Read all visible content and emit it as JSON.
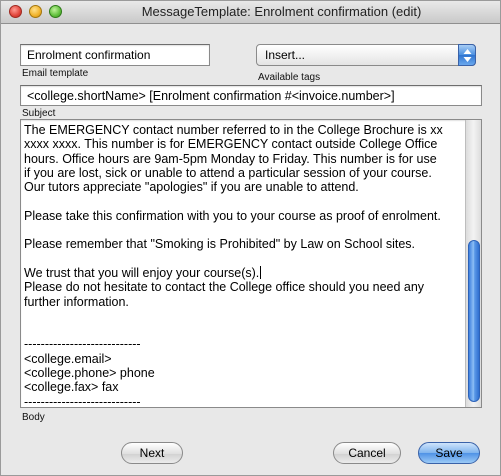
{
  "window": {
    "title": "MessageTemplate: Enrolment confirmation (edit)"
  },
  "template_name": {
    "value": "Enrolment confirmation",
    "label": "Email template"
  },
  "tags": {
    "selected": "Insert...",
    "label": "Available tags"
  },
  "subject": {
    "value": "<college.shortName> [Enrolment confirmation #<invoice.number>]",
    "label": "Subject"
  },
  "body": {
    "label": "Body",
    "lines": [
      "The EMERGENCY contact number referred to in the College Brochure is xx",
      "xxxx xxxx. This number is for EMERGENCY contact outside College Office",
      "hours. Office hours are 9am-5pm Monday to Friday. This number is for use",
      "if you are lost, sick or unable to attend a particular session of your course.",
      "Our tutors appreciate \"apologies\" if you are unable to attend.",
      "",
      "Please take this confirmation with you to your course as proof of enrolment.",
      "",
      "Please remember that \"Smoking is Prohibited\" by Law on School sites.",
      "",
      "We trust that you will enjoy your course(s).",
      "Please do not hesitate to contact the College office should you need any",
      "further information.",
      "",
      "",
      "----------------------------",
      "<college.email>",
      "<college.phone> phone",
      "<college.fax> fax",
      "----------------------------"
    ]
  },
  "buttons": {
    "next": "Next",
    "cancel": "Cancel",
    "save": "Save"
  }
}
